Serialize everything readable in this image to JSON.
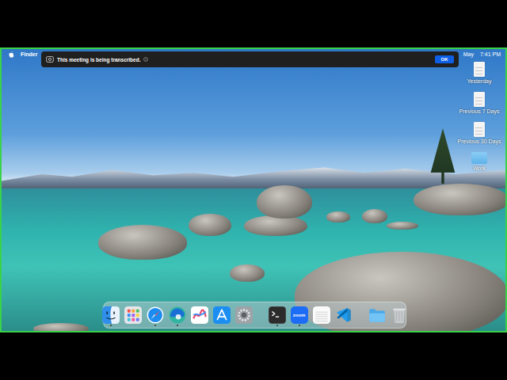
{
  "menu_bar": {
    "app": "Finder",
    "date": "May",
    "time": "7:41 PM"
  },
  "banner": {
    "text": "This meeting is being transcribed.",
    "button": "OK"
  },
  "desktop_items": [
    {
      "label": "Yesterday",
      "kind": "file"
    },
    {
      "label": "Previous 7 Days",
      "kind": "file"
    },
    {
      "label": "Previous 30 Days",
      "kind": "file"
    },
    {
      "label": "Work",
      "kind": "folder"
    }
  ],
  "dock": [
    [
      {
        "kind": "finder",
        "running": true
      },
      {
        "kind": "launchpad",
        "running": false
      },
      {
        "kind": "safari",
        "running": true
      },
      {
        "kind": "edge",
        "running": true
      },
      {
        "kind": "freeform",
        "running": false
      },
      {
        "kind": "appstore",
        "running": false
      },
      {
        "kind": "settings",
        "running": false
      }
    ],
    [
      {
        "kind": "terminal",
        "running": true
      },
      {
        "kind": "zoom",
        "running": true,
        "label": "zoom"
      },
      {
        "kind": "notes",
        "running": false
      },
      {
        "kind": "vscode",
        "running": false
      }
    ],
    [
      {
        "kind": "downloads",
        "running": false
      },
      {
        "kind": "trash",
        "running": false
      }
    ]
  ]
}
